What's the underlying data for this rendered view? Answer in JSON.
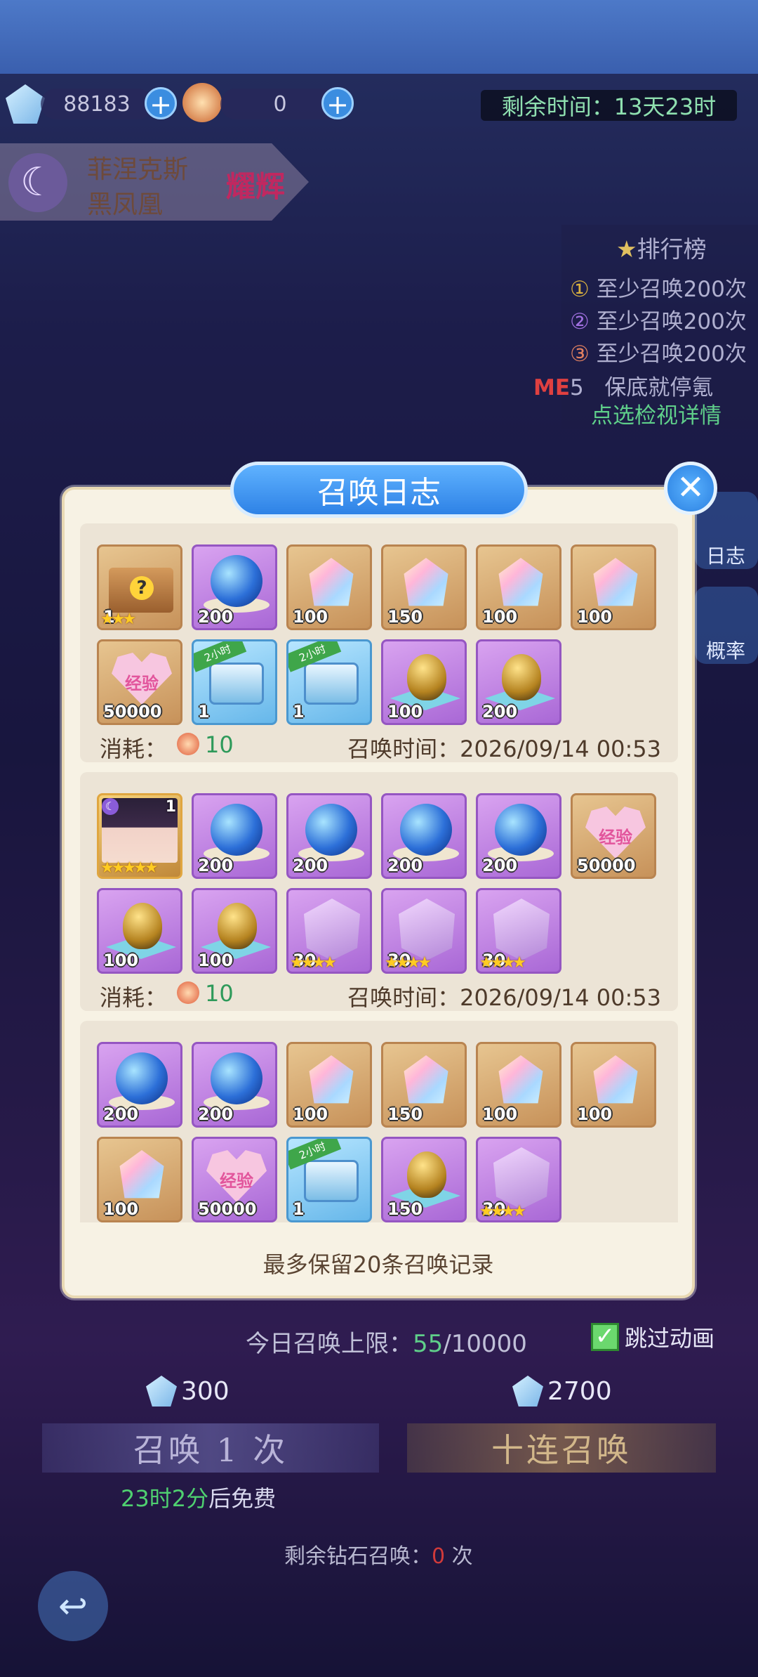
{
  "top": {
    "diamonds": "88183",
    "tickets": "0",
    "remaining_time": "剩余时间：13天23时"
  },
  "character": {
    "name": "菲涅克斯",
    "title": "黑凤凰",
    "rank_badge": "耀辉"
  },
  "ranking": {
    "title": "排行榜",
    "lines": [
      "至少召唤200次",
      "至少召唤200次",
      "至少召唤200次"
    ],
    "me_label": "ME",
    "me_rank": "5",
    "pity": "保底就停氪",
    "detail_link": "点选检视详情"
  },
  "side_buttons": {
    "log": "日志",
    "rate": "概率"
  },
  "modal": {
    "title": "召唤日志",
    "close_icon": "close-icon",
    "footer_note": "最多保留20条召唤记录",
    "consume_label": "消耗：",
    "time_label": "召唤时间：",
    "records": [
      {
        "cost": "10",
        "time": "2026/09/14 00:53",
        "items": [
          {
            "type": "mystery-box",
            "bg": "gold",
            "qty": "1",
            "stars": "★★★"
          },
          {
            "type": "blue-orb",
            "bg": "purple",
            "qty": "200"
          },
          {
            "type": "gem",
            "bg": "gold",
            "qty": "100"
          },
          {
            "type": "gem",
            "bg": "gold",
            "qty": "150"
          },
          {
            "type": "gem",
            "bg": "gold",
            "qty": "100"
          },
          {
            "type": "gem",
            "bg": "gold",
            "qty": "100"
          },
          {
            "type": "exp-heart",
            "bg": "gold",
            "qty": "50000",
            "label": "经验"
          },
          {
            "type": "chest",
            "bg": "blue",
            "qty": "1",
            "badge": "2小时"
          },
          {
            "type": "chest",
            "bg": "blue",
            "qty": "1",
            "badge": "2小时"
          },
          {
            "type": "golden-egg",
            "bg": "purple",
            "qty": "100"
          },
          {
            "type": "golden-egg",
            "bg": "purple",
            "qty": "200"
          }
        ]
      },
      {
        "cost": "10",
        "time": "2026/09/14 00:53",
        "items": [
          {
            "type": "character",
            "bg": "char",
            "qty": "1",
            "stars": "★★★★★"
          },
          {
            "type": "blue-orb",
            "bg": "purple",
            "qty": "200"
          },
          {
            "type": "blue-orb",
            "bg": "purple",
            "qty": "200"
          },
          {
            "type": "blue-orb",
            "bg": "purple",
            "qty": "200"
          },
          {
            "type": "blue-orb",
            "bg": "purple",
            "qty": "200"
          },
          {
            "type": "exp-heart",
            "bg": "gold",
            "qty": "50000",
            "label": "经验"
          },
          {
            "type": "golden-egg",
            "bg": "purple",
            "qty": "100"
          },
          {
            "type": "golden-egg",
            "bg": "purple",
            "qty": "100"
          },
          {
            "type": "crystal",
            "bg": "purple",
            "qty": "30",
            "stars": "★★★★"
          },
          {
            "type": "crystal",
            "bg": "purple",
            "qty": "30",
            "stars": "★★★★"
          },
          {
            "type": "crystal",
            "bg": "purple",
            "qty": "30",
            "stars": "★★★★"
          }
        ]
      },
      {
        "cost": "",
        "time": "",
        "items": [
          {
            "type": "blue-orb",
            "bg": "purple",
            "qty": "200"
          },
          {
            "type": "blue-orb",
            "bg": "purple",
            "qty": "200"
          },
          {
            "type": "gem",
            "bg": "gold",
            "qty": "100"
          },
          {
            "type": "gem",
            "bg": "gold",
            "qty": "150"
          },
          {
            "type": "gem",
            "bg": "gold",
            "qty": "100"
          },
          {
            "type": "gem",
            "bg": "gold",
            "qty": "100"
          },
          {
            "type": "gem",
            "bg": "gold",
            "qty": "100"
          },
          {
            "type": "exp-heart",
            "bg": "purple",
            "qty": "50000",
            "label": "经验"
          },
          {
            "type": "chest",
            "bg": "blue",
            "qty": "1",
            "badge": "2小时"
          },
          {
            "type": "golden-egg",
            "bg": "purple",
            "qty": "150"
          },
          {
            "type": "crystal",
            "bg": "purple",
            "qty": "30",
            "stars": "★★★★"
          }
        ]
      }
    ]
  },
  "bottom": {
    "daily_limit_label": "今日召唤上限：",
    "daily_used": "55",
    "daily_max": "/10000",
    "skip_animation": "跳过动画",
    "single_cost": "300",
    "ten_cost": "2700",
    "single_btn": "召唤 1 次",
    "ten_btn": "十连召唤",
    "free_timer": "23时2分",
    "free_suffix": "后免费",
    "remaining_diamond_prefix": "剩余钻石召唤：",
    "remaining_diamond_count": "0",
    "remaining_diamond_suffix": "次"
  },
  "colors": {
    "accent_blue": "#2e82e6",
    "green_text": "#2e9a5a",
    "modal_bg": "#f7f2e4"
  }
}
